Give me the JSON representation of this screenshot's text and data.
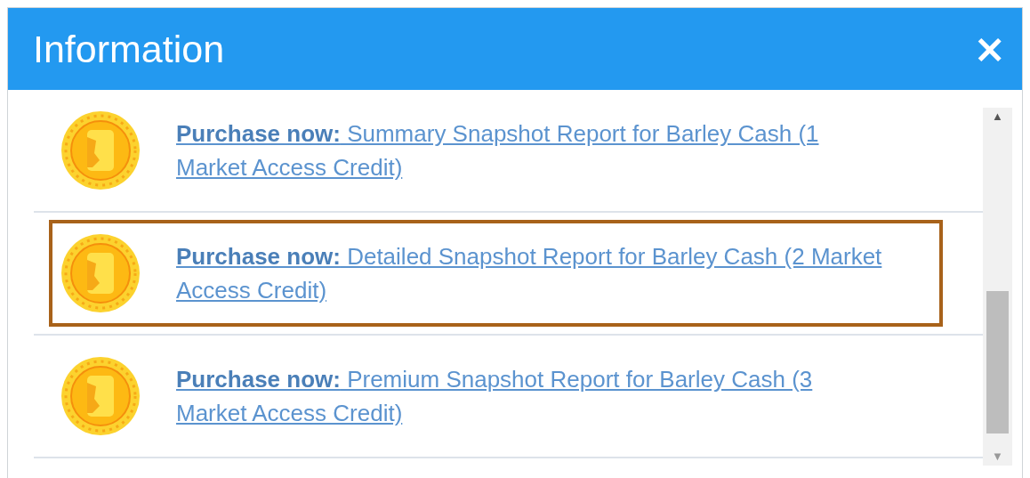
{
  "dialog": {
    "title": "Information",
    "close": "×"
  },
  "items": [
    {
      "text": "**Purchase now:** Summary Snapshot Report for Barley Cash (1 Market Access Credit)",
      "selected": false
    },
    {
      "text": "**Purchase now:** Detailed Snapshot Report for Barley Cash (2 Market Access Credit)",
      "selected": true
    },
    {
      "text": "**Purchase now:** Premium Snapshot Report for Barley Cash (3 Market Access Credit)",
      "selected": false
    }
  ],
  "scrollbar": {
    "up": "▲",
    "down": "▼"
  }
}
